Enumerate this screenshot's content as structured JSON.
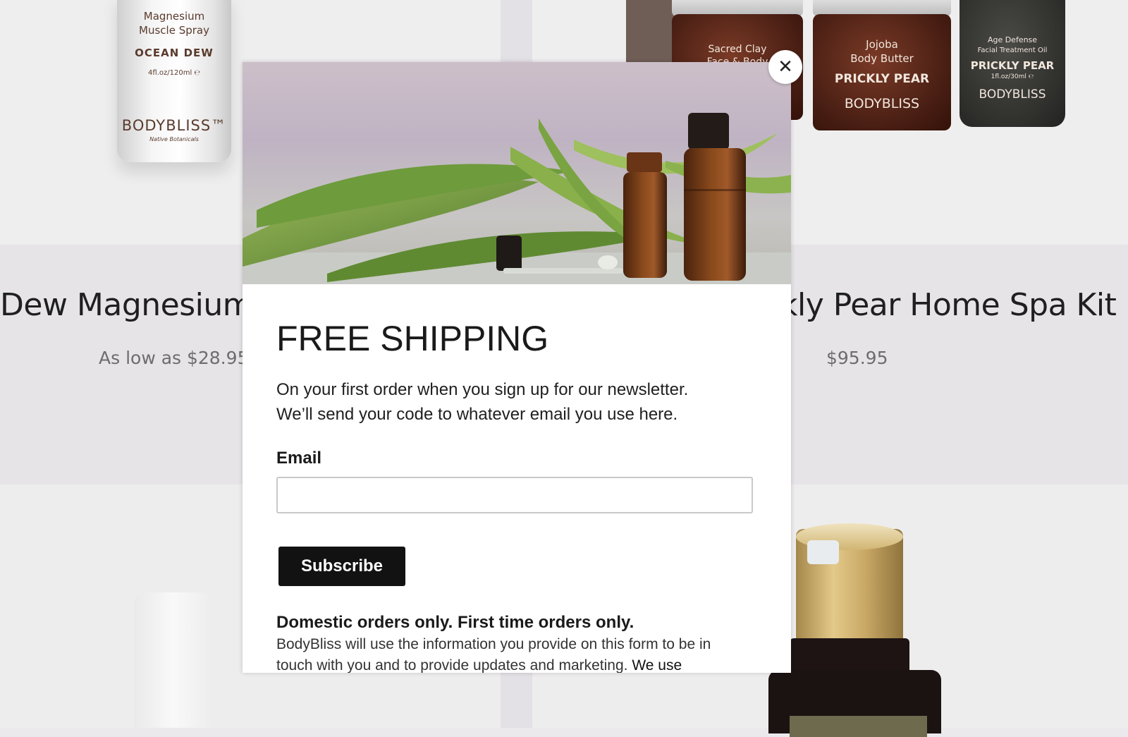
{
  "products": [
    {
      "title": "Dew Magnesium",
      "price": "As low as $28.95",
      "bottle_lines": [
        "Magnesium",
        "Muscle Spray",
        "OCEAN DEW",
        "4fl.oz/120ml ℮",
        "BODYBLISS™",
        "Native Botanicals"
      ]
    },
    {
      "title": "kly Pear Home Spa Kit",
      "price": "$95.95",
      "jars": [
        {
          "lines": [
            "Sacred Clay",
            "Face & Body"
          ]
        },
        {
          "lines": [
            "Jojoba",
            "Body Butter",
            "PRICKLY PEAR",
            "BODYBLISS"
          ]
        },
        {
          "lines": [
            "Age Defense",
            "Facial Treatment Oil",
            "PRICKLY PEAR",
            "1fl.oz/30ml ℮",
            "BODYBLISS"
          ]
        }
      ]
    }
  ],
  "modal": {
    "close_icon": "close-icon",
    "title": "FREE SHIPPING",
    "subtitle_line1": "On your first order when you sign up for our newsletter.",
    "subtitle_line2": "We’ll send your code to whatever email you use here.",
    "email_label": "Email",
    "email_value": "",
    "email_placeholder": "",
    "subscribe_label": "Subscribe",
    "note": "Domestic orders only. First time orders only.",
    "legal_line1": "BodyBliss will use the information you provide on this form to be in",
    "legal_line2_a": "touch with you and to provide updates and marketing.",
    "legal_line2_b": "We use"
  },
  "colors": {
    "page_bg": "#ebe9ec",
    "button_bg": "#121212",
    "button_text": "#ffffff",
    "title_text": "#1a1a1a",
    "price_text": "#6d6d6d"
  }
}
